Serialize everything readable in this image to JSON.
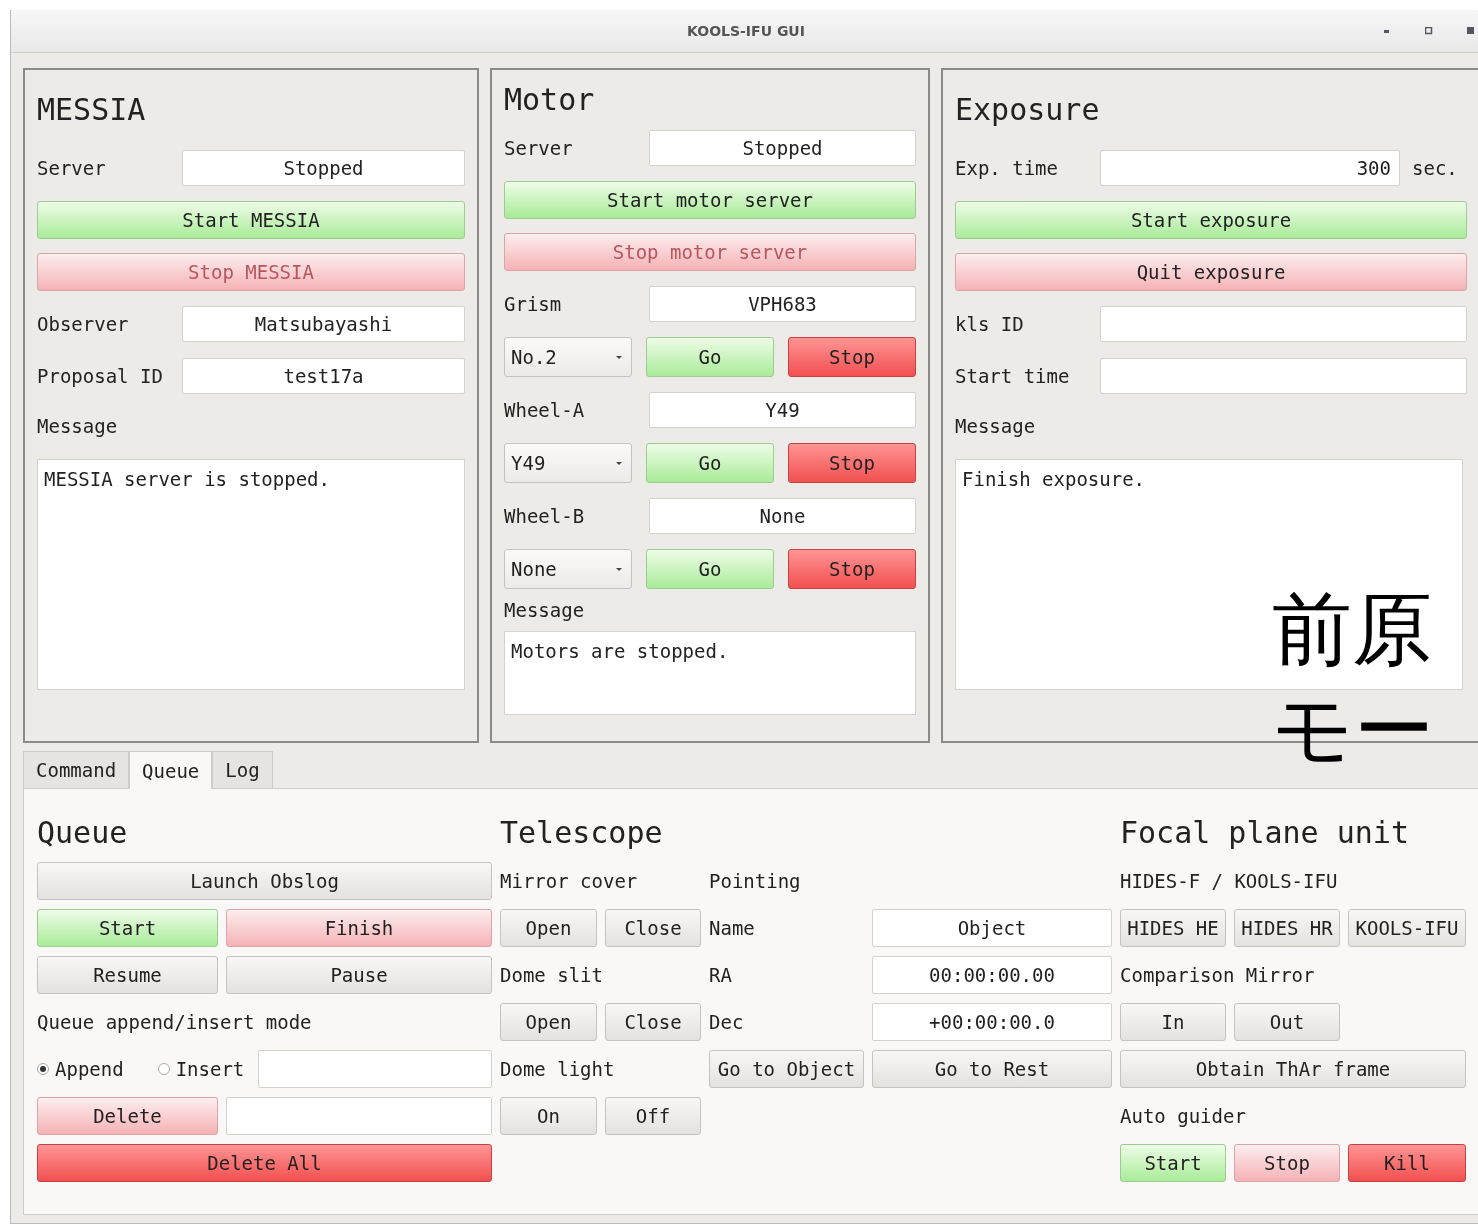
{
  "window": {
    "title": "KOOLS-IFU GUI"
  },
  "messia": {
    "title": "MESSIA",
    "server": {
      "label": "Server",
      "value": "Stopped"
    },
    "buttons": [
      {
        "label": "Start MESSIA",
        "kind": "green",
        "disabled": false
      },
      {
        "label": "Stop MESSIA",
        "kind": "pink",
        "disabled": true
      }
    ],
    "fields": [
      {
        "label": "Observer",
        "value": "Matsubayashi"
      },
      {
        "label": "Proposal ID",
        "value": "test17a"
      }
    ],
    "message_label": "Message",
    "message": "MESSIA server is stopped."
  },
  "motor": {
    "title": "Motor",
    "server": {
      "label": "Server",
      "value": "Stopped"
    },
    "buttons": [
      {
        "label": "Start motor server",
        "kind": "green",
        "disabled": false
      },
      {
        "label": "Stop motor server",
        "kind": "pink",
        "disabled": true
      }
    ],
    "axes": [
      {
        "label": "Grism",
        "value": "VPH683",
        "choice": "No.2",
        "buttons": [
          {
            "label": "Go",
            "kind": "green"
          },
          {
            "label": "Stop",
            "kind": "red"
          }
        ]
      },
      {
        "label": "Wheel-A",
        "value": "Y49",
        "choice": "Y49",
        "buttons": [
          {
            "label": "Go",
            "kind": "green"
          },
          {
            "label": "Stop",
            "kind": "red"
          }
        ]
      },
      {
        "label": "Wheel-B",
        "value": "None",
        "choice": "None",
        "buttons": [
          {
            "label": "Go",
            "kind": "green"
          },
          {
            "label": "Stop",
            "kind": "red"
          }
        ]
      }
    ],
    "message_label": "Message",
    "message": "Motors are stopped."
  },
  "exposure": {
    "title": "Exposure",
    "exp_time": {
      "label": "Exp. time",
      "value": "300",
      "unit": "sec."
    },
    "buttons": [
      {
        "label": "Start exposure",
        "kind": "green",
        "disabled": false
      },
      {
        "label": "Quit exposure",
        "kind": "pink",
        "disabled": false
      }
    ],
    "fields": [
      {
        "label": "kls ID"
      },
      {
        "label": "Start time"
      }
    ],
    "message_label": "Message",
    "message": "Finish exposure."
  },
  "tabs": [
    {
      "label": "Command",
      "selected": false
    },
    {
      "label": "Queue",
      "selected": true
    },
    {
      "label": "Log",
      "selected": false
    }
  ],
  "queue": {
    "title": "Queue",
    "launch": {
      "label": "Launch Obslog",
      "kind": "plain"
    },
    "buttons": [
      {
        "label": "Start",
        "kind": "green"
      },
      {
        "label": "Finish",
        "kind": "pink"
      },
      {
        "label": "Resume",
        "kind": "plain"
      },
      {
        "label": "Pause",
        "kind": "plain"
      }
    ],
    "mode_label": "Queue append/insert mode",
    "modes": [
      {
        "label": "Append",
        "selected": true
      },
      {
        "label": "Insert",
        "selected": false
      }
    ],
    "delete": {
      "label": "Delete",
      "kind": "pink"
    },
    "delete_all": {
      "label": "Delete All",
      "kind": "red"
    }
  },
  "telescope": {
    "title": "Telescope",
    "groups": [
      {
        "label": "Mirror cover",
        "buttons": [
          "Open",
          "Close"
        ]
      },
      {
        "label": "Dome slit",
        "buttons": [
          "Open",
          "Close"
        ]
      },
      {
        "label": "Dome light",
        "buttons": [
          "On",
          "Off"
        ]
      }
    ],
    "pointing": {
      "label": "Pointing",
      "fields": [
        {
          "label": "Name",
          "value": "Object"
        },
        {
          "label": "RA",
          "value": "00:00:00.00"
        },
        {
          "label": "Dec",
          "value": "+00:00:00.0"
        }
      ],
      "buttons": [
        "Go to Object",
        "Go to Rest"
      ]
    }
  },
  "focal_plane": {
    "title": "Focal plane unit",
    "mode_label": "HIDES-F / KOOLS-IFU",
    "modes": [
      "HIDES HE",
      "HIDES HR",
      "KOOLS-IFU"
    ],
    "mirror_label": "Comparison Mirror",
    "mirror_buttons": [
      "In",
      "Out"
    ],
    "thar": "Obtain ThAr frame",
    "guider_label": "Auto guider",
    "guider_buttons": [
      {
        "label": "Start",
        "kind": "green"
      },
      {
        "label": "Stop",
        "kind": "pink"
      },
      {
        "label": "Kill",
        "kind": "red"
      }
    ]
  },
  "overlay_caption": [
    "前原",
    "モー"
  ]
}
